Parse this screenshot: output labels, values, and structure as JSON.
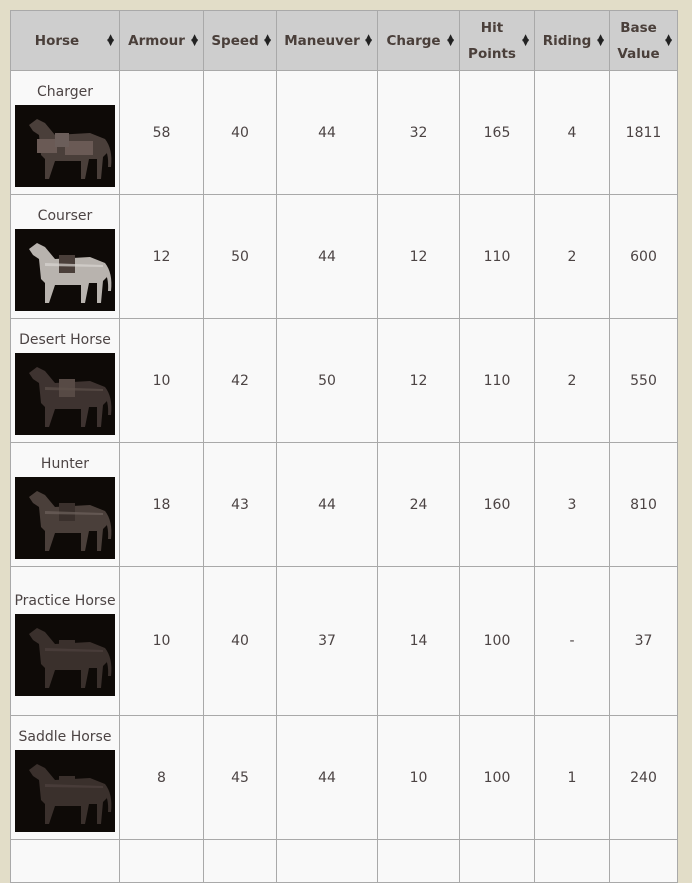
{
  "table": {
    "columns": [
      {
        "label": "Horse",
        "sort_icon": "sort-both-icon"
      },
      {
        "label": "Armour",
        "sort_icon": "sort-both-icon"
      },
      {
        "label": "Speed",
        "sort_icon": "sort-both-icon"
      },
      {
        "label": "Maneuver",
        "sort_icon": "sort-both-icon"
      },
      {
        "label": "Charge",
        "sort_icon": "sort-both-icon"
      },
      {
        "label": "Hit Points",
        "sort_icon": "sort-both-icon"
      },
      {
        "label": "Riding",
        "sort_icon": "sort-both-icon"
      },
      {
        "label": "Base Value",
        "sort_icon": "sort-both-icon"
      }
    ],
    "rows": [
      {
        "name": "Charger",
        "image": "charger-image",
        "armour": "58",
        "speed": "40",
        "maneuver": "44",
        "charge": "32",
        "hit_points": "165",
        "riding": "4",
        "base_value": "1811"
      },
      {
        "name": "Courser",
        "image": "courser-image",
        "armour": "12",
        "speed": "50",
        "maneuver": "44",
        "charge": "12",
        "hit_points": "110",
        "riding": "2",
        "base_value": "600"
      },
      {
        "name": "Desert Horse",
        "image": "desert-horse-image",
        "armour": "10",
        "speed": "42",
        "maneuver": "50",
        "charge": "12",
        "hit_points": "110",
        "riding": "2",
        "base_value": "550"
      },
      {
        "name": "Hunter",
        "image": "hunter-image",
        "armour": "18",
        "speed": "43",
        "maneuver": "44",
        "charge": "24",
        "hit_points": "160",
        "riding": "3",
        "base_value": "810"
      },
      {
        "name": "Practice Horse",
        "image": "practice-horse-image",
        "armour": "10",
        "speed": "40",
        "maneuver": "37",
        "charge": "14",
        "hit_points": "100",
        "riding": "-",
        "base_value": "37"
      },
      {
        "name": "Saddle Horse",
        "image": "saddle-horse-image",
        "armour": "8",
        "speed": "45",
        "maneuver": "44",
        "charge": "10",
        "hit_points": "100",
        "riding": "1",
        "base_value": "240"
      }
    ]
  },
  "colors": {
    "page_bg": "#e2ddc8",
    "header_bg": "#cecece",
    "cell_bg": "#f9f9f9",
    "border": "#a9a9a9",
    "text": "#4a3f3a"
  }
}
